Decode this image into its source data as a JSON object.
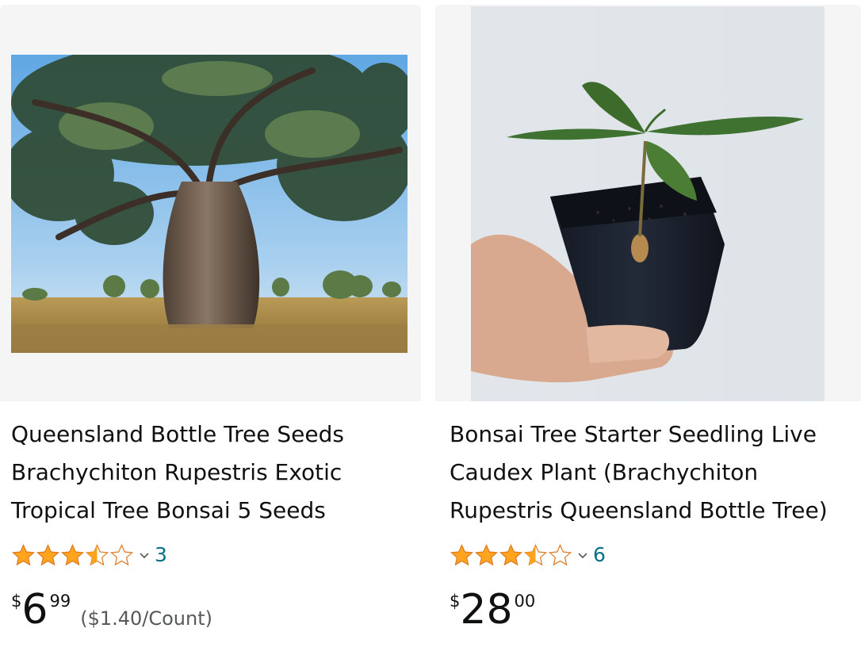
{
  "products": [
    {
      "title": "Queensland Bottle Tree Seeds Brachychiton Rupestris Exotic Tropical Tree Bonsai 5 Seeds",
      "rating": 3.5,
      "rating_max": 5,
      "review_count": "3",
      "price": {
        "symbol": "$",
        "whole": "6",
        "fraction": "99"
      },
      "unit_price": "($1.40/Count)",
      "image_icon": "bottle-tree-photo"
    },
    {
      "title": "Bonsai Tree Starter Seedling Live Caudex Plant (Brachychiton Rupestris Queensland Bottle Tree)",
      "rating": 3.5,
      "rating_max": 5,
      "review_count": "6",
      "price": {
        "symbol": "$",
        "whole": "28",
        "fraction": "00"
      },
      "image_icon": "seedling-in-pot-photo"
    }
  ],
  "colors": {
    "star": "#ffa41c",
    "link": "#007185",
    "image_bg": "#f5f5f5",
    "text": "#0f1111",
    "muted": "#565959"
  }
}
